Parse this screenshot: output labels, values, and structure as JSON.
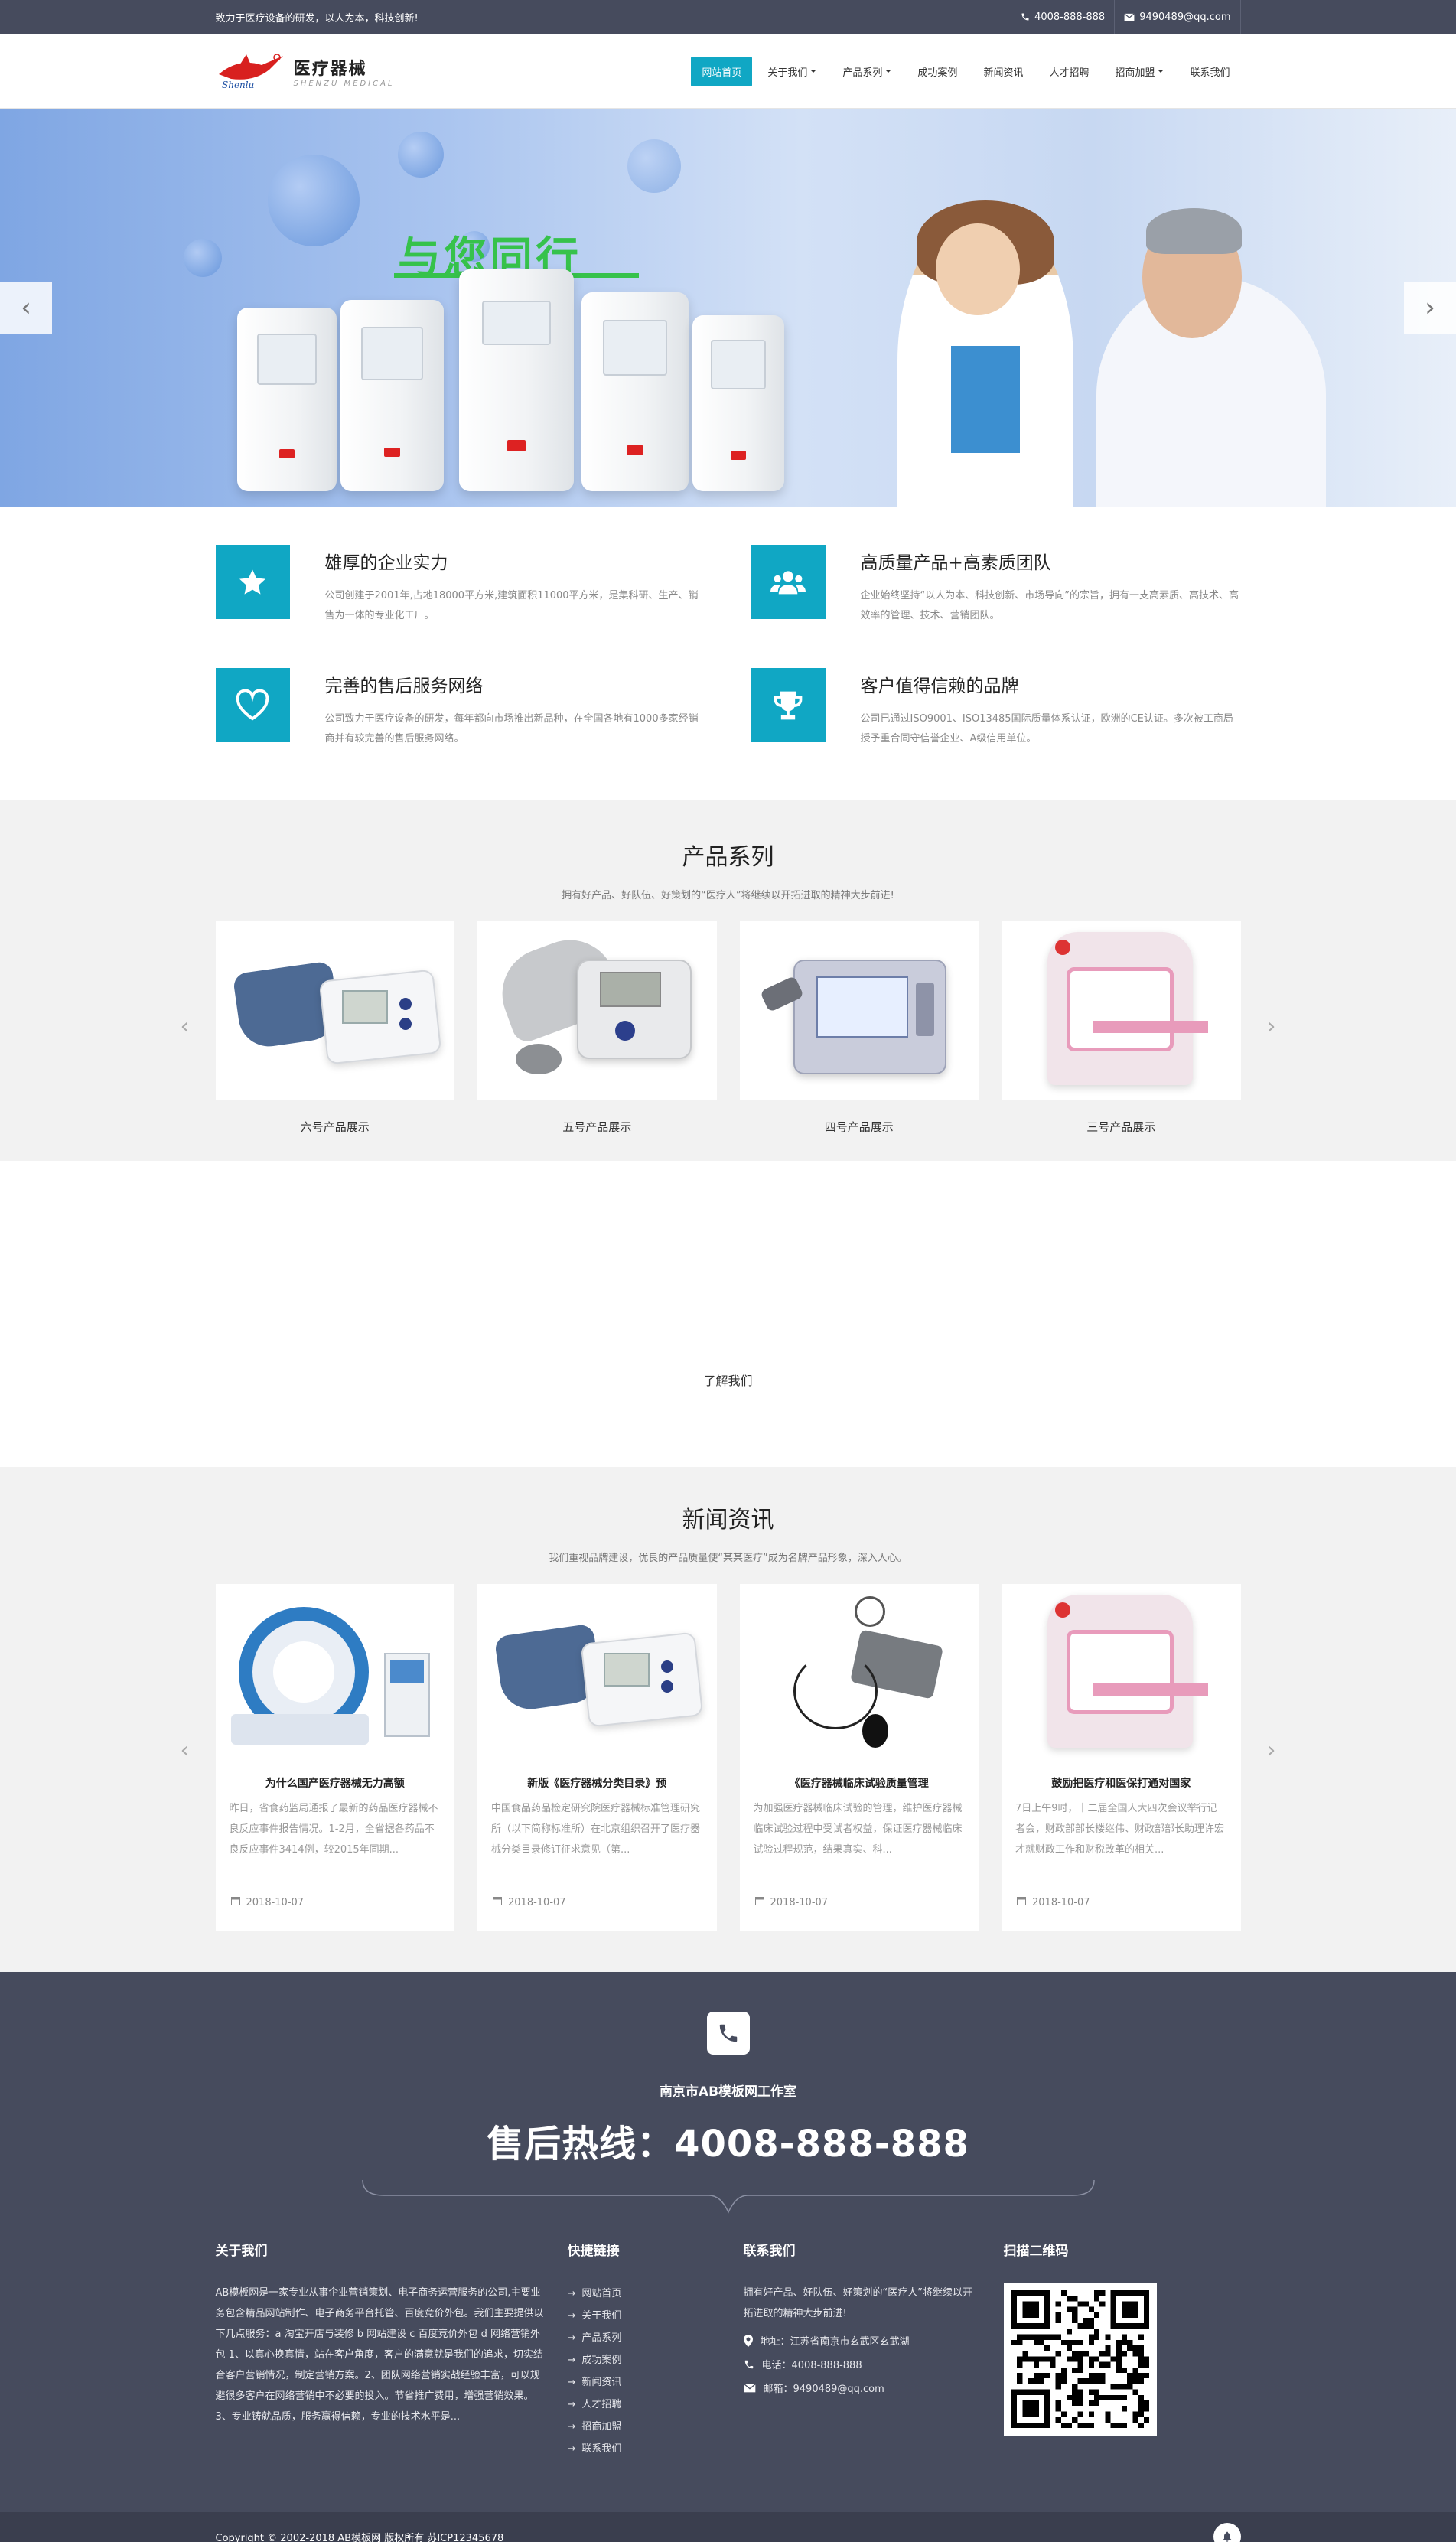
{
  "topbar": {
    "slogan": "致力于医疗设备的研发，以人为本，科技创新!",
    "phone": "4008-888-888",
    "email": "9490489@qq.com"
  },
  "header": {
    "logo_cn": "医疗器械",
    "logo_en": "SHENZU MEDICAL",
    "logo_mark": "Shenlu",
    "nav": [
      {
        "label": "网站首页",
        "active": true,
        "dropdown": false
      },
      {
        "label": "关于我们",
        "active": false,
        "dropdown": true
      },
      {
        "label": "产品系列",
        "active": false,
        "dropdown": true
      },
      {
        "label": "成功案例",
        "active": false,
        "dropdown": false
      },
      {
        "label": "新闻资讯",
        "active": false,
        "dropdown": false
      },
      {
        "label": "人才招聘",
        "active": false,
        "dropdown": false
      },
      {
        "label": "招商加盟",
        "active": false,
        "dropdown": true
      },
      {
        "label": "联系我们",
        "active": false,
        "dropdown": false
      }
    ]
  },
  "banner": {
    "slogan": "与您同行",
    "prev": "‹",
    "next": "›"
  },
  "features": [
    {
      "icon": "star-icon",
      "title": "雄厚的企业实力",
      "desc": "公司创建于2001年,占地18000平方米,建筑面积11000平方米，是集科研、生产、销售为一体的专业化工厂。"
    },
    {
      "icon": "team-icon",
      "title": "高质量产品+高素质团队",
      "desc": "企业始终坚持“以人为本、科技创新、市场导向”的宗旨，拥有一支高素质、高技术、高效率的管理、技术、营销团队。"
    },
    {
      "icon": "heart-icon",
      "title": "完善的售后服务网络",
      "desc": "公司致力于医疗设备的研发，每年都向市场推出新品种，在全国各地有1000多家经销商并有较完善的售后服务网络。"
    },
    {
      "icon": "trophy-icon",
      "title": "客户值得信赖的品牌",
      "desc": "公司已通过ISO9001、ISO13485国际质量体系认证，欧洲的CE认证。多次被工商局授予重合同守信誉企业、A级信用单位。"
    }
  ],
  "products": {
    "title": "产品系列",
    "subtitle": "拥有好产品、好队伍、好策划的“医疗人”将继续以开拓进取的精神大步前进!",
    "items": [
      {
        "name": "六号产品展示",
        "kind": "bp-monitor"
      },
      {
        "name": "五号产品展示",
        "kind": "bp-gray"
      },
      {
        "name": "四号产品展示",
        "kind": "device-screen"
      },
      {
        "name": "三号产品展示",
        "kind": "cabinet"
      }
    ]
  },
  "about": {
    "link": "了解我们"
  },
  "news": {
    "title": "新闻资讯",
    "subtitle": "我们重视品牌建设，优良的产品质量使“某某医疗”成为名牌产品形象，深入人心。",
    "items": [
      {
        "title": "为什么国产医疗器械无力高额",
        "desc": "昨日，省食药监局通报了最新的药品医疗器械不良反应事件报告情况。1-2月，全省据各药品不良反应事件3414例，较2015年同期...",
        "date": "2018-10-07",
        "kind": "ct"
      },
      {
        "title": "新版《医疗器械分类目录》预",
        "desc": "中国食品药品检定研究院医疗器械标准管理研究所（以下简称标准所）在北京组织召开了医疗器械分类目录修订征求意见（第...",
        "date": "2018-10-07",
        "kind": "bp-monitor"
      },
      {
        "title": "《医疗器械临床试验质量管理",
        "desc": "为加强医疗器械临床试验的管理，维护医疗器械临床试验过程中受试者权益，保证医疗器械临床试验过程规范，结果真实、科...",
        "date": "2018-10-07",
        "kind": "sphygmo"
      },
      {
        "title": "鼓励把医疗和医保打通对国家",
        "desc": "7日上午9时，十二届全国人大四次会议举行记者会，财政部部长楼继伟、财政部部长助理许宏才就财政工作和财税改革的相关...",
        "date": "2018-10-07",
        "kind": "cabinet"
      }
    ]
  },
  "hotline": {
    "company": "南京市AB模板网工作室",
    "text": "售后热线：4008-888-888"
  },
  "footer": {
    "about_title": "关于我们",
    "about_text": "AB模板网是一家专业从事企业营销策划、电子商务运营服务的公司,主要业务包含精品网站制作、电子商务平台托管、百度竞价外包。我们主要提供以下几点服务：a 淘宝开店与装修 b 网站建设 c 百度竞价外包 d 网络营销外包 1、以真心换真情，站在客户角度，客户的满意就是我们的追求，切实结合客户营销情况，制定营销方案。2、团队网络营销实战经验丰富，可以规避很多客户在网络营销中不必要的投入。节省推广费用，增强营销效果。3、专业铸就品质，服务赢得信赖，专业的技术水平是...",
    "links_title": "快捷链接",
    "links": [
      "网站首页",
      "关于我们",
      "产品系列",
      "成功案例",
      "新闻资讯",
      "人才招聘",
      "招商加盟",
      "联系我们"
    ],
    "contact_title": "联系我们",
    "contact_text": "拥有好产品、好队伍、好策划的“医疗人”将继续以开拓进取的精神大步前进!",
    "address": "地址：江苏省南京市玄武区玄武湖",
    "tel": "电话：4008-888-888",
    "mail": "邮箱：9490489@qq.com",
    "qr_title": "扫描二维码"
  },
  "copyright": "Copyright © 2002-2018 AB模板网 版权所有 苏ICP12345678",
  "colors": {
    "accent": "#10a7c4",
    "dark": "#464b5d",
    "darker": "#3a3e4e"
  }
}
